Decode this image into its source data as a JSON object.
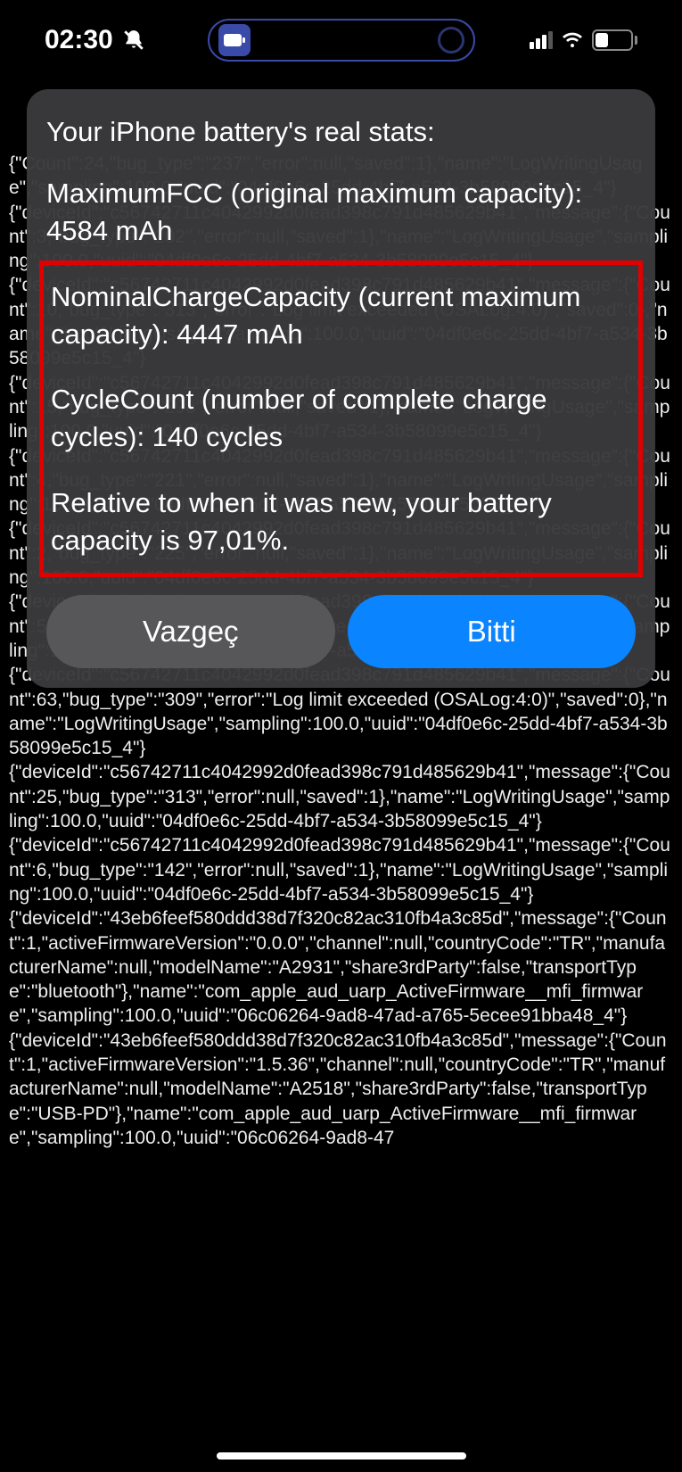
{
  "status": {
    "time": "02:30",
    "battery_pct": "36"
  },
  "alert": {
    "title": "Your iPhone battery's real stats:",
    "max_fcc": "MaximumFCC (original maximum capacity): 4584 mAh",
    "nominal": "NominalChargeCapacity (current maximum capacity): 4447 mAh",
    "cycles": "CycleCount (number of complete charge cycles): 140 cycles",
    "relative": "Relative to when it was new, your battery capacity is 97,01%.",
    "cancel_label": "Vazgeç",
    "done_label": "Bitti"
  },
  "log": "{\"Count\":24,\"bug_type\":\"237\",\"error\":null,\"saved\":1},\"name\":\"LogWritingUsage\",\"sampling\":100.0,\"uuid\":\"04df0e6c-25dd-4bf7-a534-3b58099e5c15_4\"}\n{\"deviceId\":\"c56742711c4042992d0fead398c791d485629b41\",\"message\":{\"Count\":3,\"bug_type\":\"202\",\"error\":null,\"saved\":1},\"name\":\"LogWritingUsage\",\"sampling\":100.0,\"uuid\":\"04df0e6c-25dd-4bf7-a534-3b58099e5c15_4\"}\n{\"deviceId\":\"c56742711c4042992d0fead398c791d485629b41\",\"message\":{\"Count\":10,\"bug_type\":\"313\",\"error\":\"Log limit exceeded (OSALog:4:0)\",\"saved\":0},\"name\":\"LogWritingUsage\",\"sampling\":100.0,\"uuid\":\"04df0e6c-25dd-4bf7-a534-3b58099e5c15_4\"}\n{\"deviceId\":\"c56742711c4042992d0fead398c791d485629b41\",\"message\":{\"Count\":15,\"bug_type\":\"298\",\"error\":null,\"saved\":1},\"name\":\"LogWritingUsage\",\"sampling\":100.0,\"uuid\":\"04df0e6c-25dd-4bf7-a534-3b58099e5c15_4\"}\n{\"deviceId\":\"c56742711c4042992d0fead398c791d485629b41\",\"message\":{\"Count\":4,\"bug_type\":\"221\",\"error\":null,\"saved\":1},\"name\":\"LogWritingUsage\",\"sampling\":100.0,\"uuid\":\"04df0e6c-25dd-4bf7-a534-3b58099e5c15_4\"}\n{\"deviceId\":\"c56742711c4042992d0fead398c791d485629b41\",\"message\":{\"Count\":2,\"bug_type\":\"225\",\"error\":null,\"saved\":1},\"name\":\"LogWritingUsage\",\"sampling\":100.0,\"uuid\":\"04df0e6c-25dd-4bf7-a534-3b58099e5c15_4\"}\n{\"deviceId\":\"c56742711c4042992d0fead398c791d485629b41\",\"message\":{\"Count\":54,\"bug_type\":\"309\",\"error\":null,\"saved\":1},\"name\":\"LogWritingUsage\",\"sampling\":100.0,\"uuid\":\"04df0e6c-25dd-4bf7-a534-3b58099e5c15_4\"}\n{\"deviceId\":\"c56742711c4042992d0fead398c791d485629b41\",\"message\":{\"Count\":63,\"bug_type\":\"309\",\"error\":\"Log limit exceeded (OSALog:4:0)\",\"saved\":0},\"name\":\"LogWritingUsage\",\"sampling\":100.0,\"uuid\":\"04df0e6c-25dd-4bf7-a534-3b58099e5c15_4\"}\n{\"deviceId\":\"c56742711c4042992d0fead398c791d485629b41\",\"message\":{\"Count\":25,\"bug_type\":\"313\",\"error\":null,\"saved\":1},\"name\":\"LogWritingUsage\",\"sampling\":100.0,\"uuid\":\"04df0e6c-25dd-4bf7-a534-3b58099e5c15_4\"}\n{\"deviceId\":\"c56742711c4042992d0fead398c791d485629b41\",\"message\":{\"Count\":6,\"bug_type\":\"142\",\"error\":null,\"saved\":1},\"name\":\"LogWritingUsage\",\"sampling\":100.0,\"uuid\":\"04df0e6c-25dd-4bf7-a534-3b58099e5c15_4\"}\n{\"deviceId\":\"43eb6feef580ddd38d7f320c82ac310fb4a3c85d\",\"message\":{\"Count\":1,\"activeFirmwareVersion\":\"0.0.0\",\"channel\":null,\"countryCode\":\"TR\",\"manufacturerName\":null,\"modelName\":\"A2931\",\"share3rdParty\":false,\"transportType\":\"bluetooth\"},\"name\":\"com_apple_aud_uarp_ActiveFirmware__mfi_firmware\",\"sampling\":100.0,\"uuid\":\"06c06264-9ad8-47ad-a765-5ecee91bba48_4\"}\n{\"deviceId\":\"43eb6feef580ddd38d7f320c82ac310fb4a3c85d\",\"message\":{\"Count\":1,\"activeFirmwareVersion\":\"1.5.36\",\"channel\":null,\"countryCode\":\"TR\",\"manufacturerName\":null,\"modelName\":\"A2518\",\"share3rdParty\":false,\"transportType\":\"USB-PD\"},\"name\":\"com_apple_aud_uarp_ActiveFirmware__mfi_firmware\",\"sampling\":100.0,\"uuid\":\"06c06264-9ad8-47"
}
